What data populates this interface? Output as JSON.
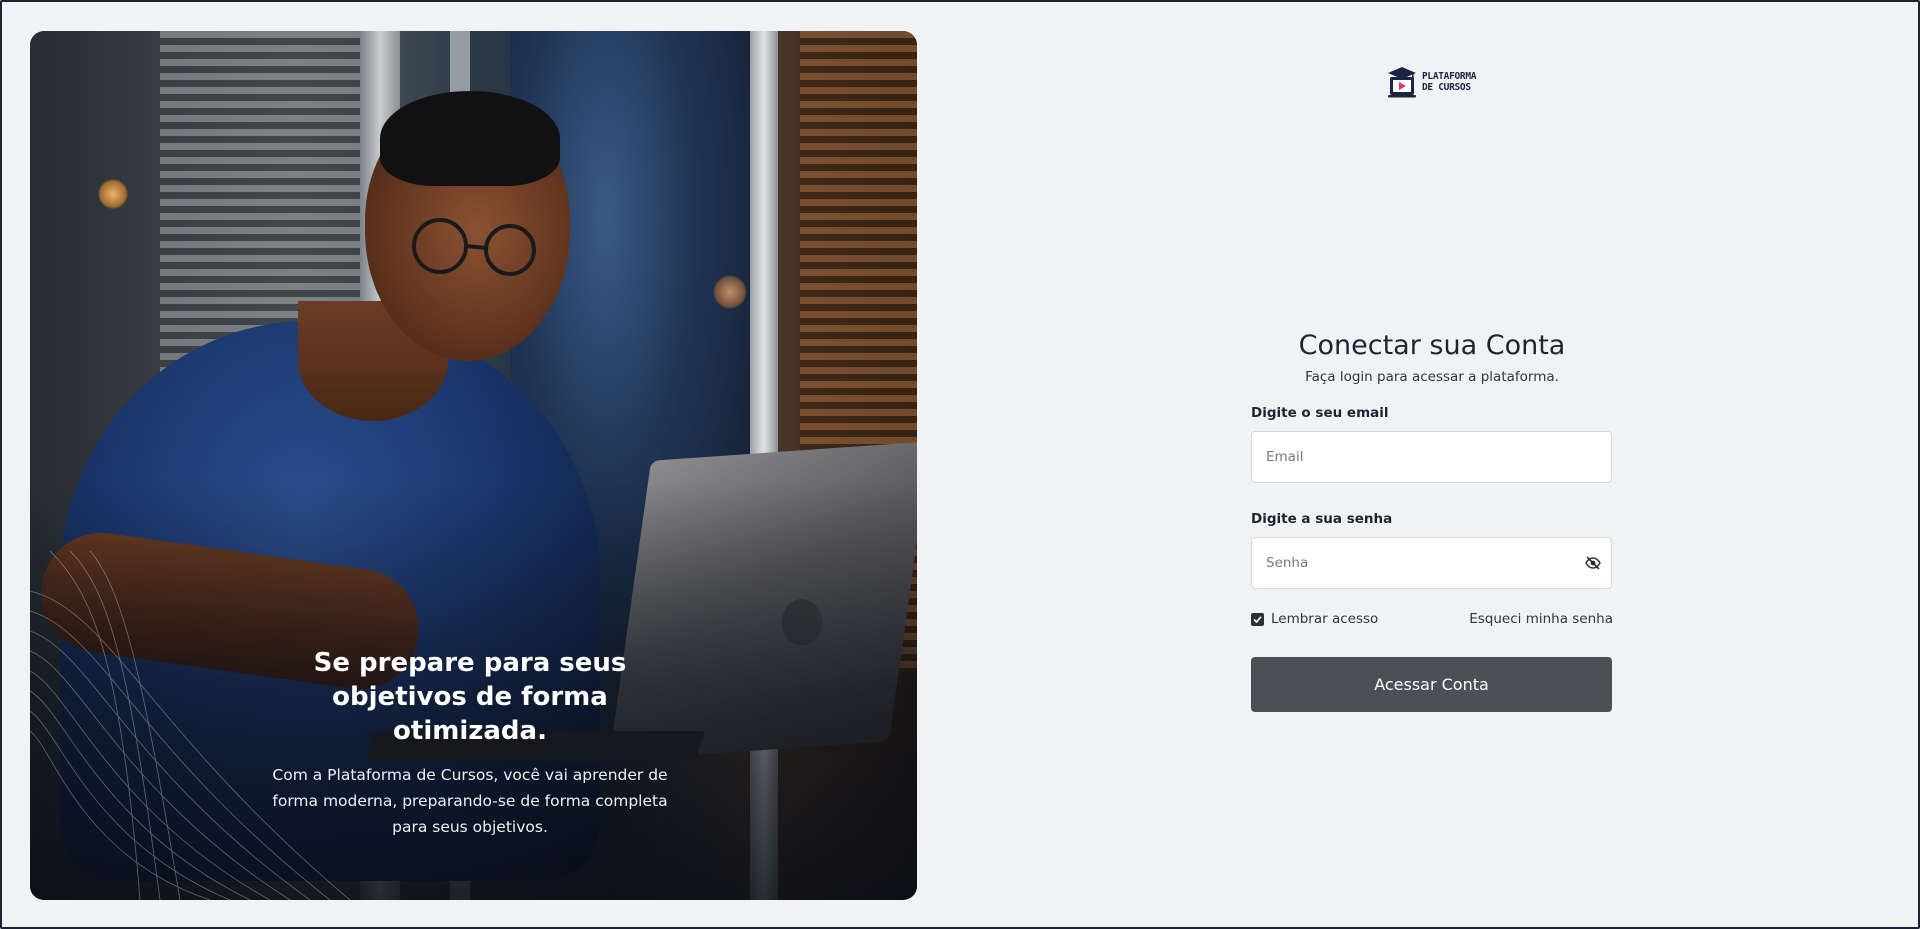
{
  "hero": {
    "title": "Se prepare para seus\nobjetivos de forma\notimizada.",
    "description": "Com a Plataforma de Cursos, você vai aprender de\nforma moderna, preparando-se de forma completa\npara seus objetivos."
  },
  "brand": {
    "logo_text": "PLATAFORMA\nDE CURSOS",
    "logo_icon": "graduation-laptop-icon",
    "color_navy": "#1b2540",
    "color_accent": "#e2336b"
  },
  "login": {
    "title": "Conectar sua Conta",
    "subtitle": "Faça login para acessar a plataforma.",
    "email_label": "Digite o seu email",
    "email_placeholder": "Email",
    "email_value": "",
    "password_label": "Digite a sua senha",
    "password_placeholder": "Senha",
    "password_value": "",
    "password_toggle_icon": "eye-slash-icon",
    "remember_label": "Lembrar acesso",
    "remember_checked": true,
    "forgot_label": "Esqueci minha senha",
    "submit_label": "Acessar Conta",
    "submit_color": "#4b4f56"
  }
}
